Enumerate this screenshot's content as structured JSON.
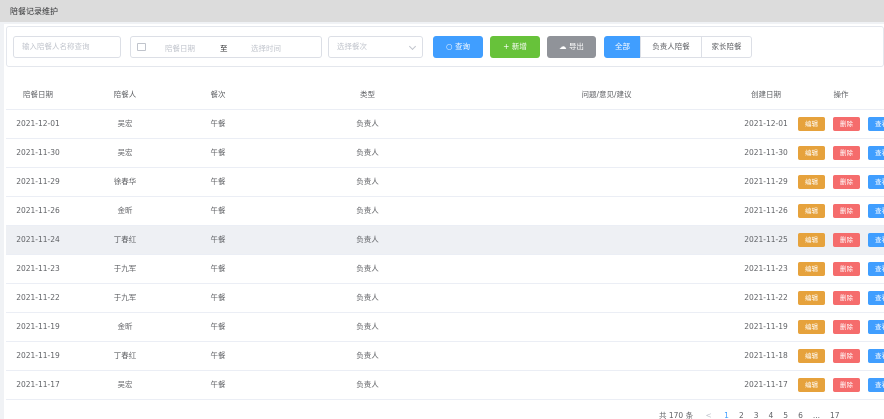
{
  "page": {
    "title": "陪餐记录维护"
  },
  "filters": {
    "search_placeholder": "输入陪餐人名称查询",
    "date_start_placeholder": "陪餐日期",
    "date_separator": "至",
    "date_end_placeholder": "选择时间",
    "meal_select_placeholder": "选择餐次",
    "query_label": "查询",
    "add_label": "新增",
    "export_label": "导出",
    "segments": [
      "全部",
      "负责人陪餐",
      "家长陪餐"
    ]
  },
  "table": {
    "headers": [
      "陪餐日期",
      "陪餐人",
      "餐次",
      "类型",
      "问题/意见/建议",
      "创建日期",
      "操作"
    ],
    "rows": [
      {
        "date": "2021-12-01",
        "person": "吴宏",
        "meal": "午餐",
        "type": "负责人",
        "issue": "",
        "created": "2021-12-01"
      },
      {
        "date": "2021-11-30",
        "person": "吴宏",
        "meal": "午餐",
        "type": "负责人",
        "issue": "",
        "created": "2021-11-30"
      },
      {
        "date": "2021-11-29",
        "person": "徐春华",
        "meal": "午餐",
        "type": "负责人",
        "issue": "",
        "created": "2021-11-29"
      },
      {
        "date": "2021-11-26",
        "person": "金昕",
        "meal": "午餐",
        "type": "负责人",
        "issue": "",
        "created": "2021-11-26"
      },
      {
        "date": "2021-11-24",
        "person": "丁春红",
        "meal": "午餐",
        "type": "负责人",
        "issue": "",
        "created": "2021-11-25"
      },
      {
        "date": "2021-11-23",
        "person": "于九军",
        "meal": "午餐",
        "type": "负责人",
        "issue": "",
        "created": "2021-11-23"
      },
      {
        "date": "2021-11-22",
        "person": "于九军",
        "meal": "午餐",
        "type": "负责人",
        "issue": "",
        "created": "2021-11-22"
      },
      {
        "date": "2021-11-19",
        "person": "金昕",
        "meal": "午餐",
        "type": "负责人",
        "issue": "",
        "created": "2021-11-19"
      },
      {
        "date": "2021-11-19",
        "person": "丁春红",
        "meal": "午餐",
        "type": "负责人",
        "issue": "",
        "created": "2021-11-18"
      },
      {
        "date": "2021-11-17",
        "person": "吴宏",
        "meal": "午餐",
        "type": "负责人",
        "issue": "",
        "created": "2021-11-17"
      }
    ],
    "actions": {
      "edit": "编辑",
      "delete": "删除",
      "view": "查看"
    }
  },
  "pagination": {
    "total_text": "共 170 条",
    "prev": "<",
    "pages": [
      "1",
      "2",
      "3",
      "4",
      "5",
      "6",
      "...",
      "17"
    ],
    "current": "1"
  },
  "colors": {
    "primary": "#409eff",
    "success": "#67c23a",
    "info": "#909399",
    "warning": "#e6a23c",
    "danger": "#f56c6c"
  }
}
